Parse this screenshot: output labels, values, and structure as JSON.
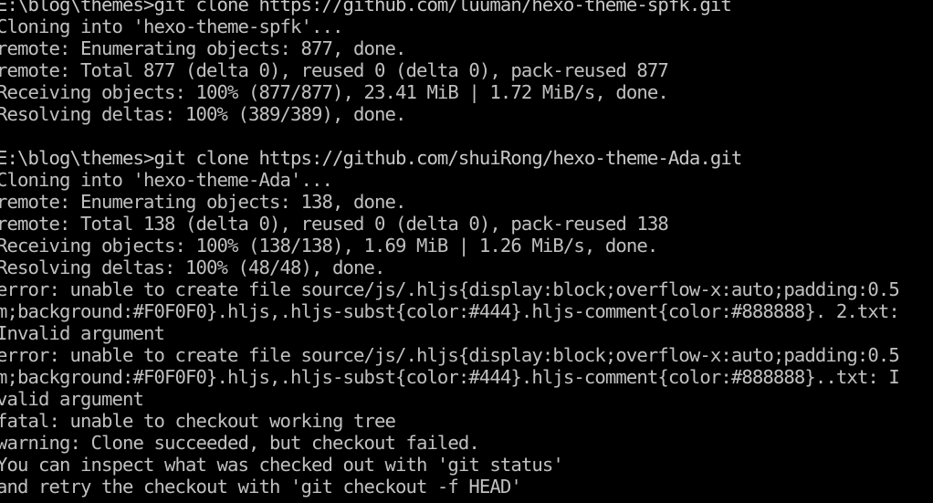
{
  "window": {
    "background": "#000000",
    "foreground": "#c0c0c0"
  },
  "terminal": {
    "lines": [
      "E:\\blog\\themes>git clone https://github.com/luuman/hexo-theme-spfk.git",
      "Cloning into 'hexo-theme-spfk'...",
      "remote: Enumerating objects: 877, done.",
      "remote: Total 877 (delta 0), reused 0 (delta 0), pack-reused 877",
      "Receiving objects: 100% (877/877), 23.41 MiB | 1.72 MiB/s, done.",
      "Resolving deltas: 100% (389/389), done.",
      "",
      "E:\\blog\\themes>git clone https://github.com/shuiRong/hexo-theme-Ada.git",
      "Cloning into 'hexo-theme-Ada'...",
      "remote: Enumerating objects: 138, done.",
      "remote: Total 138 (delta 0), reused 0 (delta 0), pack-reused 138",
      "Receiving objects: 100% (138/138), 1.69 MiB | 1.26 MiB/s, done.",
      "Resolving deltas: 100% (48/48), done.",
      "error: unable to create file source/js/.hljs{display:block;overflow-x:auto;padding:0.5",
      "m;background:#F0F0F0}.hljs,.hljs-subst{color:#444}.hljs-comment{color:#888888}. 2.txt:",
      "Invalid argument",
      "error: unable to create file source/js/.hljs{display:block;overflow-x:auto;padding:0.5",
      "m;background:#F0F0F0}.hljs,.hljs-subst{color:#444}.hljs-comment{color:#888888}..txt: I",
      "valid argument",
      "fatal: unable to checkout working tree",
      "warning: Clone succeeded, but checkout failed.",
      "You can inspect what was checked out with 'git status'",
      "and retry the checkout with 'git checkout -f HEAD'"
    ]
  }
}
